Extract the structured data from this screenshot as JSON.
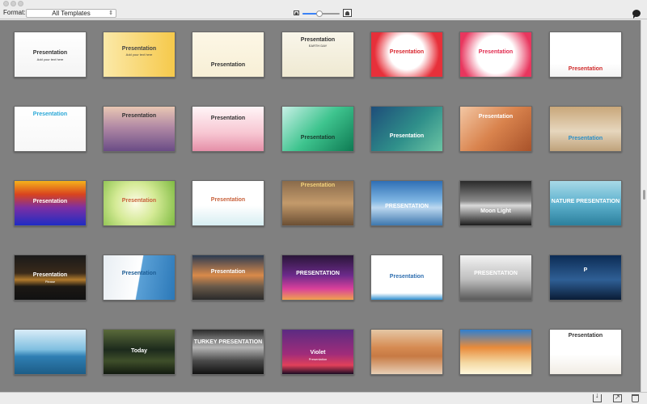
{
  "toolbar": {
    "format_label": "Format:",
    "format_value": "All Templates",
    "zoom_level": 0.45
  },
  "templates": [
    {
      "title": "Presentation",
      "subtitle": "Add your text here",
      "bg": "linear-gradient(180deg,#ffffff,#f4f4f4)",
      "color": "#333333",
      "pos": "top:40%"
    },
    {
      "title": "Presentation",
      "subtitle": "Add your text here",
      "bg": "linear-gradient(90deg,#fbe9a8,#f6c94b)",
      "color": "#444444",
      "pos": "top:30%"
    },
    {
      "title": "Presentation",
      "subtitle": "",
      "bg": "linear-gradient(180deg,#fdf7e6,#f7efd6)",
      "color": "#333333",
      "pos": "top:68%"
    },
    {
      "title": "Presentation",
      "subtitle": "EARTH DAY",
      "bg": "linear-gradient(180deg,#f9f6ea,#efe9d2)",
      "color": "#333333",
      "pos": "top:10%"
    },
    {
      "title": "Presentation",
      "subtitle": "",
      "bg": "radial-gradient(circle at 50% 45%,#ffffff 40%,#e7303a 75%)",
      "color": "#d9262f",
      "pos": "top:38%"
    },
    {
      "title": "Presentation",
      "subtitle": "",
      "bg": "radial-gradient(circle at 50% 50%,#ffffff 45%,#e8365e 85%)",
      "color": "#e22b4f",
      "pos": "top:38%"
    },
    {
      "title": "Presentation",
      "subtitle": "",
      "bg": "linear-gradient(180deg,#ffffff 70%,#f2f2f2)",
      "color": "#d12c2c",
      "pos": "top:76%"
    },
    {
      "title": "Presentation",
      "subtitle": "",
      "bg": "linear-gradient(180deg,#ffffff,#f7f7f7)",
      "color": "#2aa8d7",
      "pos": "top:10%"
    },
    {
      "title": "Presentation",
      "subtitle": "",
      "bg": "linear-gradient(180deg,#e9c7b3 0%,#b28aa5 45%,#6a4c86 100%)",
      "color": "#333333",
      "pos": "top:14%"
    },
    {
      "title": "Presentation",
      "subtitle": "",
      "bg": "linear-gradient(180deg,#fff5f7 0%,#f7c6d2 60%,#e58fa8 100%)",
      "color": "#333333",
      "pos": "top:20%"
    },
    {
      "title": "Presentation",
      "subtitle": "",
      "bg": "linear-gradient(135deg,#c8f0e6 0%,#3ec48e 50%,#0e7a53 100%)",
      "color": "#1a3b2e",
      "pos": "top:64%"
    },
    {
      "title": "Presentation",
      "subtitle": "",
      "bg": "linear-gradient(135deg,#1e4d7a 0%,#2f8f8a 55%,#6cc5a4 100%)",
      "color": "#ffffff",
      "pos": "top:60%"
    },
    {
      "title": "Presentation",
      "subtitle": "",
      "bg": "linear-gradient(135deg,#f3c7a4 0%,#d9834d 50%,#a8522a 100%)",
      "color": "#ffffff",
      "pos": "top:16%"
    },
    {
      "title": "Presentation",
      "subtitle": "",
      "bg": "linear-gradient(180deg,#c9a77a 0%,#e6d6bd 55%,#bfa27b 100%)",
      "color": "#2a8fc9",
      "pos": "top:66%"
    },
    {
      "title": "Presentation",
      "subtitle": "",
      "bg": "linear-gradient(180deg,#f5b21b 0%,#d9441e 30%,#7c2fa4 60%,#1f2cc3 100%)",
      "color": "#ffffff",
      "pos": "top:40%"
    },
    {
      "title": "Presentation",
      "subtitle": "",
      "bg": "radial-gradient(circle at 45% 50%,#fdfbe6 0%,#d4ea95 45%,#7fbb42 100%)",
      "color": "#c8613b",
      "pos": "top:38%"
    },
    {
      "title": "Presentation",
      "subtitle": "",
      "bg": "linear-gradient(180deg,#ffffff 55%,#d7eef2 100%)",
      "color": "#c8613b",
      "pos": "top:36%"
    },
    {
      "title": "Presentation",
      "subtitle": "",
      "bg": "linear-gradient(180deg,#8a6b4b 0%,#c39a6b 50%,#6b4f34 100%)",
      "color": "#f2d27c",
      "pos": "top:4%"
    },
    {
      "title": "PRESENTATION",
      "subtitle": "",
      "bg": "linear-gradient(180deg,#2f6fb5 0%,#7fb6e3 45%,#bcd8ef 60%,#3d77ad 100%)",
      "color": "#ffffff",
      "pos": "top:50%"
    },
    {
      "title": "Moon Light",
      "subtitle": "",
      "bg": "linear-gradient(180deg,#2a2a2a 0%,#8a8a8a 45%,#d9d9d9 55%,#1c1c1c 100%)",
      "color": "#ffffff",
      "pos": "top:62%"
    },
    {
      "title": "NATURE PRESENTATION",
      "subtitle": "",
      "bg": "linear-gradient(180deg,#a8d9e7 0%,#5fb3cf 50%,#2b7f9c 100%)",
      "color": "#ffffff",
      "pos": "top:40%"
    },
    {
      "title": "Presentation",
      "subtitle": "Please",
      "bg": "linear-gradient(180deg,#1a1a1a 0%,#3a2a1a 40%,#b07a2d 55%,#1c1814 70%,#111 100%)",
      "color": "#ffffff",
      "pos": "top:38%"
    },
    {
      "title": "Presentation",
      "subtitle": "",
      "bg": "linear-gradient(100deg,#e8eef3 0%,#ffffff 50%,#5aa0d6 51%,#2b78b8 100%)",
      "color": "#1b5b93",
      "pos": "top:34%"
    },
    {
      "title": "Presentation",
      "subtitle": "",
      "bg": "linear-gradient(180deg,#2b3b52 0%,#d98a4a 45%,#6a5a4a 70%,#2a2a2a 100%)",
      "color": "#ffffff",
      "pos": "top:30%"
    },
    {
      "title": "PRESENTATION",
      "subtitle": "",
      "bg": "linear-gradient(180deg,#2a1638 0%,#6b2a8a 45%,#d9409b 75%,#f0a24e 100%)",
      "color": "#ffffff",
      "pos": "top:34%"
    },
    {
      "title": "Presentation",
      "subtitle": "",
      "bg": "linear-gradient(180deg,#ffffff 85%,#2f8fd0 100%)",
      "color": "#2f6fb0",
      "pos": "top:42%"
    },
    {
      "title": "PRESENTATION",
      "subtitle": "",
      "bg": "linear-gradient(180deg,#f3f3f3 0%,#bdbdbd 55%,#5a5a5a 100%)",
      "color": "#ffffff",
      "pos": "top:34%"
    },
    {
      "title": "P",
      "subtitle": "",
      "bg": "linear-gradient(180deg,#0c2c55 0%,#2f5f95 55%,#0a1c36 100%)",
      "color": "#ffffff",
      "pos": "top:28%"
    },
    {
      "title": "",
      "subtitle": "",
      "bg": "linear-gradient(180deg,#d9ecf7 0%,#7fbfe0 45%,#2f7fb3 60%,#1d5d87 100%)",
      "color": "#ffffff",
      "pos": "top:40%"
    },
    {
      "title": "Today",
      "subtitle": "",
      "bg": "linear-gradient(180deg,#5a6a3a 0%,#1c2a1c 45%,#3f4f2a 70%,#121a10 100%)",
      "color": "#ffffff",
      "pos": "top:42%"
    },
    {
      "title": "TURKEY PRESENTATION",
      "subtitle": "",
      "bg": "linear-gradient(180deg,#2a2a2a 0%,#b5b5b5 40%,#4a4a4a 70%,#111 100%)",
      "color": "#ffffff",
      "pos": "top:22%"
    },
    {
      "title": "Violet",
      "subtitle": "Presentation",
      "bg": "linear-gradient(180deg,#5b2b82 0%,#a02c7a 55%,#e0405a 80%,#1a0c24 100%)",
      "color": "#ffffff",
      "pos": "top:45%"
    },
    {
      "title": "",
      "subtitle": "",
      "bg": "linear-gradient(180deg,#e5c7a6 0%,#d68b52 40%,#c77a44 60%,#e8d0b6 100%)",
      "color": "#ffffff",
      "pos": "top:40%"
    },
    {
      "title": "",
      "subtitle": "",
      "bg": "linear-gradient(180deg,#2f7fd0 0%,#e98b3a 40%,#f4d9a4 75%,#fff8dc 100%)",
      "color": "#ffffff",
      "pos": "top:40%"
    },
    {
      "title": "Presentation",
      "subtitle": "",
      "bg": "linear-gradient(180deg,#ffffff 55%,#f1ece4 100%)",
      "color": "#333333",
      "pos": "top:8%"
    }
  ]
}
